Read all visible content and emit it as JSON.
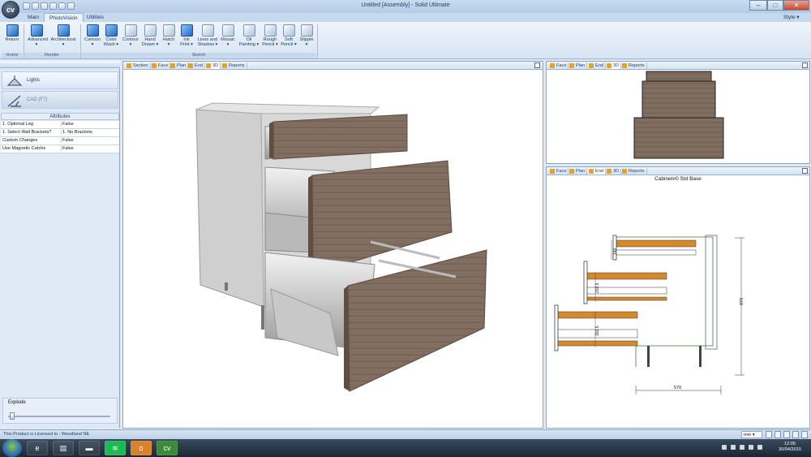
{
  "window": {
    "title": "Untitled [Assembly] - Solid Ultimate",
    "app_logo": "cv",
    "minimize": "–",
    "maximize": "□",
    "close": "✕"
  },
  "ribbon_tabs": [
    {
      "label": "Main"
    },
    {
      "label": "PhotoVision"
    },
    {
      "label": "Utilities"
    }
  ],
  "style_menu": "Style ▾",
  "ribbon": {
    "groups": [
      {
        "label": "Home"
      },
      {
        "label": "Render"
      },
      {
        "label": "Sketch"
      }
    ],
    "buttons": [
      {
        "l1": "Return",
        "l2": ""
      },
      {
        "l1": "Advanced",
        "l2": "▾"
      },
      {
        "l1": "Architectural",
        "l2": "▾"
      },
      {
        "l1": "Cartoon",
        "l2": "▾"
      },
      {
        "l1": "Color",
        "l2": "Wash ▾"
      },
      {
        "l1": "Contour",
        "l2": "▾"
      },
      {
        "l1": "Hand",
        "l2": "Drawn ▾"
      },
      {
        "l1": "Hatch",
        "l2": "▾"
      },
      {
        "l1": "Ink",
        "l2": "Print ▾"
      },
      {
        "l1": "Lines and",
        "l2": "Shadow ▾"
      },
      {
        "l1": "Mosaic",
        "l2": "▾"
      },
      {
        "l1": "Oil",
        "l2": "Painting ▾"
      },
      {
        "l1": "Rough",
        "l2": "Pencil ▾"
      },
      {
        "l1": "Soft",
        "l2": "Pencil ▾"
      },
      {
        "l1": "Stipple",
        "l2": "▾"
      }
    ]
  },
  "left_panel": {
    "lights_label": "Lights",
    "cad_label": "CAD (F7)",
    "attributes_title": "Attributes",
    "attributes": [
      {
        "name": "1. Optional Leg",
        "value": "False"
      },
      {
        "name": "1. Select Wall Brackets?",
        "value": "1. No Brackets"
      },
      {
        "name": "Custom Changes",
        "value": "False"
      },
      {
        "name": "Use Magnetic Catchs",
        "value": "False"
      }
    ],
    "explode_label": "Explode",
    "explode_value": 0
  },
  "main_view": {
    "tabs": [
      {
        "label": "Section"
      },
      {
        "label": "Face"
      },
      {
        "label": "Plan"
      },
      {
        "label": "End"
      },
      {
        "label": "3D"
      },
      {
        "label": "Reports"
      }
    ],
    "active_tab": "3D"
  },
  "top_right_view": {
    "tabs": [
      {
        "label": "Face"
      },
      {
        "label": "Plan"
      },
      {
        "label": "End"
      },
      {
        "label": "3D"
      },
      {
        "label": "Reports"
      }
    ],
    "active_tab": "3D"
  },
  "bottom_right_view": {
    "tabs": [
      {
        "label": "Face"
      },
      {
        "label": "Plan"
      },
      {
        "label": "End"
      },
      {
        "label": "3D"
      },
      {
        "label": "Reports"
      }
    ],
    "active_tab": "End",
    "drawing_title": "Cabinet#0 Std Base",
    "dimensions": {
      "height": "870",
      "width": "570",
      "drawer_1": "202.5",
      "drawer_2": "302.5",
      "drawer_3": "140"
    }
  },
  "status": {
    "license": "This Product is Licensed to : Woodland NE",
    "unit": "mm ▾"
  },
  "taskbar": {
    "time": "12:05",
    "date": "30/04/2015"
  },
  "colors": {
    "wood": "#7d6a5c",
    "ribbon_blue": "#1e395b",
    "accent": "#e5a22a"
  }
}
